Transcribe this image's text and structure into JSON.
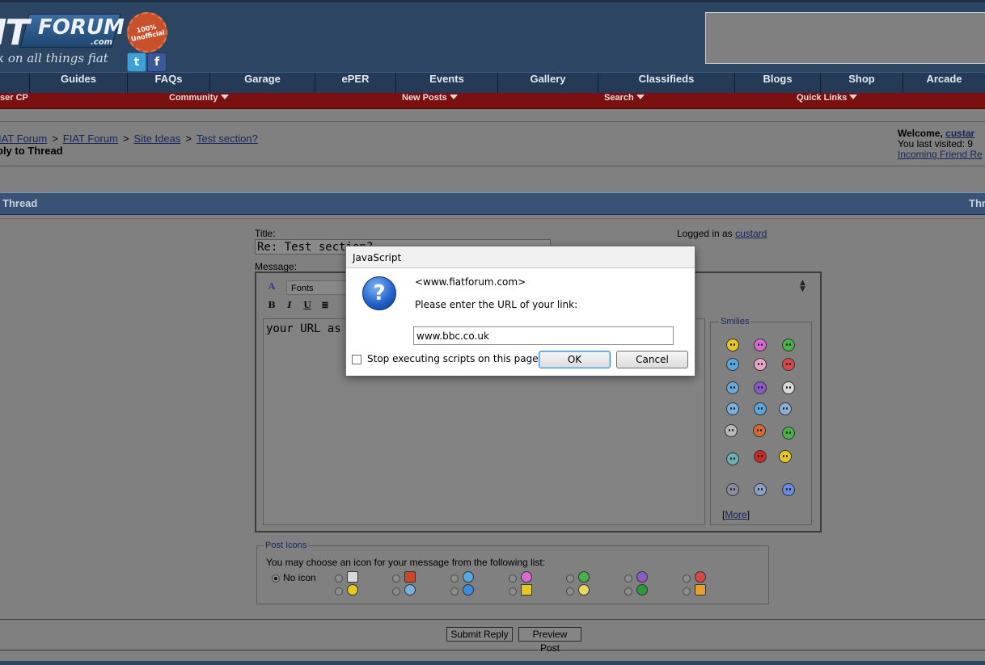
{
  "header": {
    "logo_it": "IT",
    "logo_forum": "FORUM",
    "logo_com": ".com",
    "logo_seal": "100% Unofficial",
    "tagline": "k on all things fiat",
    "twitter_glyph": "t",
    "facebook_glyph": "f"
  },
  "nav": {
    "items": [
      "Guides",
      "FAQs",
      "Garage",
      "ePER",
      "Events",
      "Gallery",
      "Classifieds",
      "Blogs",
      "Shop",
      "Arcade"
    ]
  },
  "subnav": {
    "user_cp": "ser CP",
    "community": "Community",
    "new_posts": "New Posts",
    "search": "Search",
    "quick_links": "Quick Links"
  },
  "breadcrumb": {
    "items": [
      "IAT Forum",
      "FIAT Forum",
      "Site Ideas",
      "Test section?"
    ],
    "separator": ">",
    "current": "ply to Thread"
  },
  "welcome": {
    "label": "Welcome,",
    "user": "custar",
    "last_visited": "You last visited: 9",
    "friend_requests": "Incoming Friend Re"
  },
  "thread_bar": {
    "left": "Thread",
    "right": "Thr"
  },
  "form": {
    "title_label": "Title:",
    "title_value": "Re: Test section?",
    "logged_in_label": "Logged in as",
    "logged_in_user": "custard",
    "message_label": "Message:",
    "fonts_select": "Fonts",
    "bold": "B",
    "italic": "I",
    "underline": "U",
    "message_text": "your URL as a g",
    "smilies_legend": "Smilies",
    "more_open": "[",
    "more_link": "More",
    "more_close": "]"
  },
  "post_icons": {
    "legend": "Post Icons",
    "description": "You may choose an icon for your message from the following list:",
    "no_icon_label": "No icon"
  },
  "buttons": {
    "submit": "Submit Reply",
    "preview": "Preview Post"
  },
  "dialog": {
    "title": "JavaScript",
    "origin": "<www.fiatforum.com>",
    "message": "Please enter the URL of your link:",
    "input_value": "www.bbc.co.uk",
    "checkbox_label": "Stop executing scripts on this page",
    "ok": "OK",
    "cancel": "Cancel",
    "icon_glyph": "?"
  },
  "colors": {
    "header_blue": "#2c4562",
    "subnav_red": "#7a1010",
    "page_gray": "#808080",
    "link": "#16265a"
  }
}
